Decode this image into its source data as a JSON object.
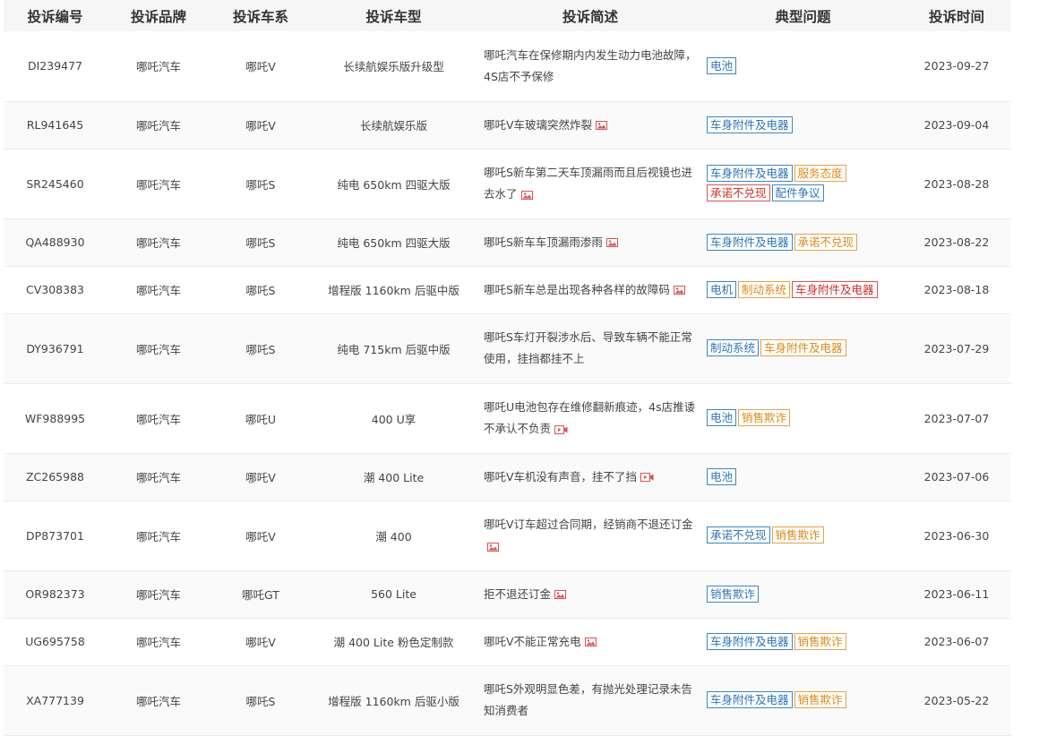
{
  "headers": [
    "投诉编号",
    "投诉品牌",
    "投诉车系",
    "投诉车型",
    "投诉简述",
    "典型问题",
    "投诉时间"
  ],
  "colors": {
    "blue": "#2f74b5",
    "orange": "#d98a1c",
    "red": "#c9302c",
    "header_bg": "#f6f6f6"
  },
  "rows": [
    {
      "id": "DI239477",
      "brand": "哪吒汽车",
      "series": "哪吒V",
      "model": "长续航娱乐版升级型",
      "desc": "哪吒汽车在保修期内内发生动力电池故障，4S店不予保修",
      "media": "",
      "tags": [
        {
          "text": "电池",
          "color": "blue"
        }
      ],
      "date": "2023-09-27"
    },
    {
      "id": "RL941645",
      "brand": "哪吒汽车",
      "series": "哪吒V",
      "model": "长续航娱乐版",
      "desc": "哪吒V车玻璃突然炸裂",
      "media": "image-icon",
      "tags": [
        {
          "text": "车身附件及电器",
          "color": "blue"
        }
      ],
      "date": "2023-09-04"
    },
    {
      "id": "SR245460",
      "brand": "哪吒汽车",
      "series": "哪吒S",
      "model": "纯电 650km 四驱大版",
      "desc": "哪吒S新车第二天车顶漏雨而且后视镜也进去水了",
      "media": "image-icon",
      "tags": [
        {
          "text": "车身附件及电器",
          "color": "blue"
        },
        {
          "text": "服务态度",
          "color": "orange"
        },
        {
          "text": "承诺不兑现",
          "color": "red"
        },
        {
          "text": "配件争议",
          "color": "blue"
        }
      ],
      "date": "2023-08-28"
    },
    {
      "id": "QA488930",
      "brand": "哪吒汽车",
      "series": "哪吒S",
      "model": "纯电 650km 四驱大版",
      "desc": "哪吒S新车车顶漏雨渗雨",
      "media": "image-icon",
      "tags": [
        {
          "text": "车身附件及电器",
          "color": "blue"
        },
        {
          "text": "承诺不兑现",
          "color": "orange"
        }
      ],
      "date": "2023-08-22"
    },
    {
      "id": "CV308383",
      "brand": "哪吒汽车",
      "series": "哪吒S",
      "model": "增程版 1160km 后驱中版",
      "desc": "哪吒S新车总是出现各种各样的故障码",
      "media": "image-icon",
      "tags": [
        {
          "text": "电机",
          "color": "blue"
        },
        {
          "text": "制动系统",
          "color": "orange"
        },
        {
          "text": "车身附件及电器",
          "color": "red"
        }
      ],
      "date": "2023-08-18"
    },
    {
      "id": "DY936791",
      "brand": "哪吒汽车",
      "series": "哪吒S",
      "model": "纯电 715km 后驱中版",
      "desc": "哪吒S车灯开裂涉水后、导致车辆不能正常使用，挂挡都挂不上",
      "media": "",
      "tags": [
        {
          "text": "制动系统",
          "color": "blue"
        },
        {
          "text": "车身附件及电器",
          "color": "orange"
        }
      ],
      "date": "2023-07-29"
    },
    {
      "id": "WF988995",
      "brand": "哪吒汽车",
      "series": "哪吒U",
      "model": "400 U享",
      "desc": "哪吒U电池包存在维修翻新痕迹，4s店推诿不承认不负责",
      "media": "video-icon",
      "tags": [
        {
          "text": "电池",
          "color": "blue"
        },
        {
          "text": "销售欺诈",
          "color": "orange"
        }
      ],
      "date": "2023-07-07"
    },
    {
      "id": "ZC265988",
      "brand": "哪吒汽车",
      "series": "哪吒V",
      "model": "潮 400 Lite",
      "desc": "哪吒V车机没有声音，挂不了挡",
      "media": "video-icon",
      "tags": [
        {
          "text": "电池",
          "color": "blue"
        }
      ],
      "date": "2023-07-06"
    },
    {
      "id": "DP873701",
      "brand": "哪吒汽车",
      "series": "哪吒V",
      "model": "潮 400",
      "desc": "哪吒V订车超过合同期，经销商不退还订金",
      "media": "image-icon",
      "tags": [
        {
          "text": "承诺不兑现",
          "color": "blue"
        },
        {
          "text": "销售欺诈",
          "color": "orange"
        }
      ],
      "date": "2023-06-30"
    },
    {
      "id": "OR982373",
      "brand": "哪吒汽车",
      "series": "哪吒GT",
      "model": "560 Lite",
      "desc": "拒不退还订金",
      "media": "image-icon",
      "tags": [
        {
          "text": "销售欺诈",
          "color": "blue"
        }
      ],
      "date": "2023-06-11"
    },
    {
      "id": "UG695758",
      "brand": "哪吒汽车",
      "series": "哪吒V",
      "model": "潮 400 Lite 粉色定制款",
      "desc": "哪吒V不能正常充电",
      "media": "image-icon",
      "tags": [
        {
          "text": "车身附件及电器",
          "color": "blue"
        },
        {
          "text": "销售欺诈",
          "color": "orange"
        }
      ],
      "date": "2023-06-07"
    },
    {
      "id": "XA777139",
      "brand": "哪吒汽车",
      "series": "哪吒S",
      "model": "增程版 1160km 后驱小版",
      "desc": "哪吒S外观明显色差，有抛光处理记录未告知消费者",
      "media": "",
      "tags": [
        {
          "text": "车身附件及电器",
          "color": "blue"
        },
        {
          "text": "销售欺诈",
          "color": "orange"
        }
      ],
      "date": "2023-05-22"
    }
  ]
}
